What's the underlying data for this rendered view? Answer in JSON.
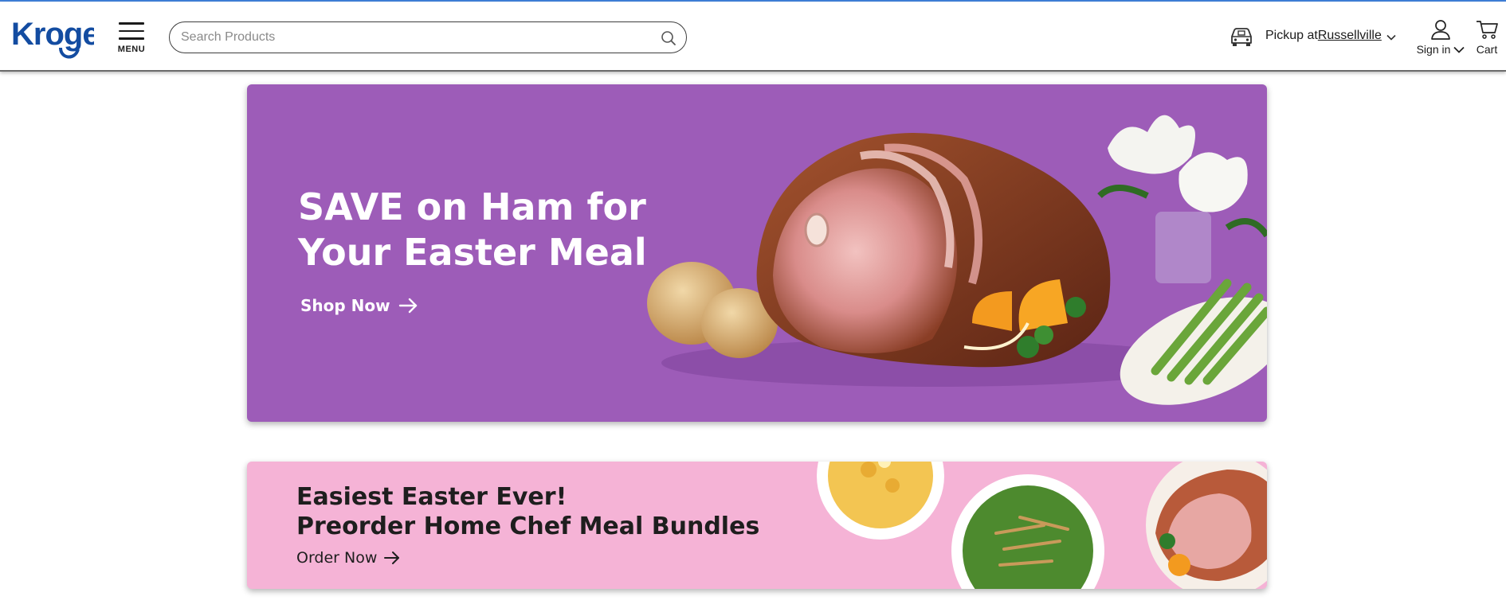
{
  "header": {
    "logo_text": "Kroger",
    "menu_label": "MENU",
    "search_placeholder": "Search Products",
    "pickup": {
      "prefix": "Pickup at ",
      "store": "Russellville"
    },
    "signin_label": "Sign in",
    "cart_label": "Cart"
  },
  "banners": [
    {
      "headline_line1": "SAVE on Ham for",
      "headline_line2": "Your Easter Meal",
      "cta": "Shop Now"
    },
    {
      "headline_line1": "Easiest Easter Ever!",
      "headline_line2": "Preorder Home Chef Meal Bundles",
      "cta": "Order Now"
    }
  ],
  "colors": {
    "brand_blue": "#134ca1",
    "banner1_bg": "#9d5cb8",
    "banner2_bg": "#f5b3d6"
  },
  "icons": [
    "hamburger-menu-icon",
    "search-icon",
    "pickup-car-icon",
    "chevron-down-icon",
    "user-icon",
    "cart-icon",
    "arrow-right-icon"
  ]
}
